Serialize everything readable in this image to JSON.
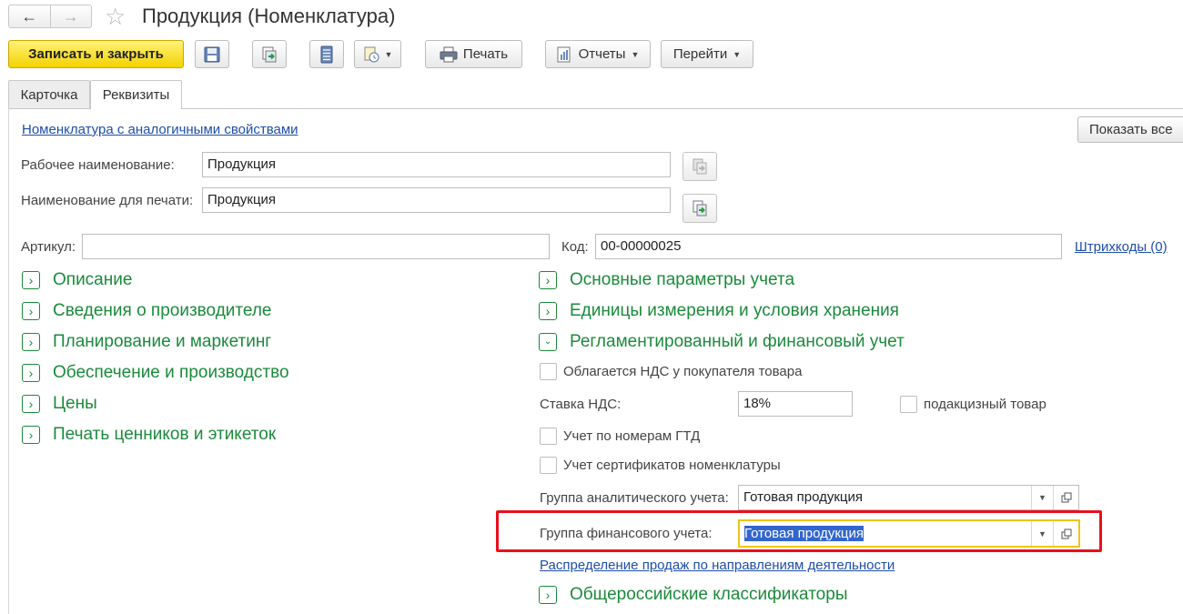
{
  "window": {
    "title": "Продукция (Номенклатура)",
    "back_glyph": "←",
    "forward_glyph": "→",
    "star_glyph": "☆"
  },
  "toolbar": {
    "save_close": "Записать и закрыть",
    "print": "Печать",
    "reports": "Отчеты",
    "goto": "Перейти"
  },
  "tabs": [
    "Карточка",
    "Реквизиты"
  ],
  "active_tab": "Реквизиты",
  "form": {
    "similar_link": "Номенклатура с аналогичными свойствами",
    "show_all": "Показать все",
    "work_name_label": "Рабочее наименование:",
    "work_name_value": "Продукция",
    "print_name_label": "Наименование для печати:",
    "print_name_value": "Продукция",
    "article_label": "Артикул:",
    "article_value": "",
    "code_label": "Код:",
    "code_value": "00-00000025",
    "barcodes_link": "Штрихкоды (0)"
  },
  "left_sections": [
    "Описание",
    "Сведения о производителе",
    "Планирование и маркетинг",
    "Обеспечение и производство",
    "Цены",
    "Печать ценников и этикеток"
  ],
  "right_sections": {
    "main_params": "Основные параметры учета",
    "units": "Единицы измерения и условия хранения",
    "regulated": "Регламентированный и финансовый учет",
    "classifiers": "Общероссийские классификаторы"
  },
  "regulated": {
    "vat_buyer": "Облагается НДС у покупателя товара",
    "vat_rate_label": "Ставка НДС:",
    "vat_rate_value": "18%",
    "excise": "подакцизный товар",
    "gtd": "Учет по номерам ГТД",
    "certs": "Учет сертификатов номенклатуры",
    "analytic_group_label": "Группа аналитического учета:",
    "analytic_group_value": "Готовая продукция",
    "fin_group_label": "Группа финансового учета:",
    "fin_group_value": "Готовая продукция",
    "sales_link": "Распределение продаж по направлениям деятельности"
  },
  "colors": {
    "accent_green": "#1b8a3c",
    "link_blue": "#1f4ea8",
    "primary_yellow": "#f2d200",
    "highlight_red": "#e8101c",
    "focus_yellow": "#f0c419",
    "selection_blue": "#3366cc"
  }
}
